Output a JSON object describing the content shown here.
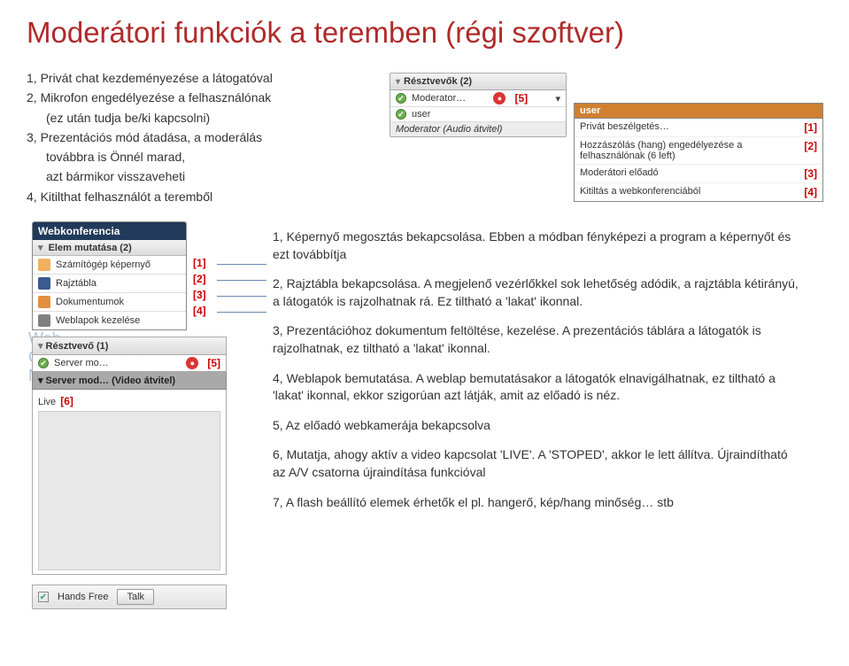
{
  "title": "Moderátori funkciók a teremben (régi szoftver)",
  "bullets": {
    "b1": "1, Privát chat kezdeményezése a látogatóval",
    "b2": "2, Mikrofon engedélyezése a felhasználónak",
    "b2i": "   (ez után tudja be/ki kapcsolni)",
    "b3": "3, Prezentációs mód átadása, a moderálás",
    "b3i": "   továbbra is Önnél marad,",
    "b3j": "   azt bármikor visszaveheti",
    "b4": "4, Kitilthat felhasználót a teremből"
  },
  "participants_panel": {
    "head": "Résztvevők (2)",
    "rows": [
      {
        "name": "Moderator…",
        "mic": true,
        "tag": "[5]"
      },
      {
        "name": "user"
      }
    ],
    "bottom": "Moderator (Audio átvitel)"
  },
  "context_menu": {
    "head": "user",
    "items": [
      {
        "label": "Privát beszélgetés…",
        "tag": "[1]"
      },
      {
        "label": "Hozzászólás (hang) engedélyezése a felhasználónak (6 left)",
        "tag": "[2]"
      },
      {
        "label": "Moderátori előadó",
        "tag": "[3]"
      },
      {
        "label": "Kitiltás a webkonferenciából",
        "tag": "[4]"
      }
    ]
  },
  "webkonf": {
    "title": "Webkonferencia",
    "sub": "Elem mutatása (2)",
    "items": [
      {
        "label": "Számítógép képernyő",
        "tag": "[1]"
      },
      {
        "label": "Rajztábla",
        "tag": "[2]"
      },
      {
        "label": "Dokumentumok",
        "tag": "[3]"
      },
      {
        "label": "Weblapok kezelése",
        "tag": "[4]"
      }
    ]
  },
  "resv": {
    "head": "Résztvevő (1)",
    "row0": {
      "name": "Server mo…",
      "mic": true,
      "tag": "[5]"
    },
    "servermo": "Server mod… (Video átvitel)",
    "live": "Live",
    "livetag": "[6]"
  },
  "grouped": {
    "a": "Web",
    "b": "Cont",
    "c": "MLS"
  },
  "handsfree": {
    "label": "Hands Free",
    "talk": "Talk"
  },
  "right": {
    "p1": "1, Képernyő megosztás bekapcsolása. Ebben a módban fényképezi a program a képernyőt és ezt továbbítja",
    "p2": "2, Rajztábla bekapcsolása. A megjelenő vezérlőkkel sok lehetőség adódik, a rajztábla kétirányú, a látogatók is rajzolhatnak rá. Ez tiltható a 'lakat' ikonnal.",
    "p3": "3, Prezentációhoz dokumentum feltöltése, kezelése. A prezentációs táblára a látogatók is rajzolhatnak, ez tiltható a 'lakat' ikonnal.",
    "p4": "4, Weblapok bemutatása. A weblap bemutatásakor a látogatók elnavigálhatnak, ez tiltható a 'lakat' ikonnal, ekkor szigorúan azt látják, amit az előadó is néz.",
    "p5": "5, Az előadó webkamerája bekapcsolva",
    "p6": "6, Mutatja, ahogy aktív a video kapcsolat 'LIVE'. A 'STOPED', akkor le lett állítva. Újraindítható az A/V csatorna újraindítása funkcióval",
    "p7": "7, A flash beállító elemek érhetők el pl. hangerő, kép/hang minőség… stb"
  }
}
